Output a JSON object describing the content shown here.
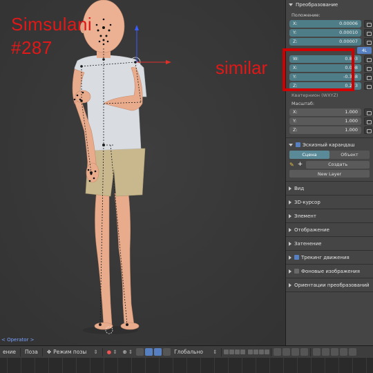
{
  "overlay": {
    "watermark_line1": "Simsulani",
    "watermark_line2": "#287",
    "annotation": "similar"
  },
  "viewport": {
    "operator_name": "< Operator >"
  },
  "properties": {
    "transform": {
      "title": "Преобразование",
      "location_label": "Положение:",
      "location": [
        {
          "axis": "X:",
          "value": "0.00006"
        },
        {
          "axis": "Y:",
          "value": "0.00010"
        },
        {
          "axis": "Z:",
          "value": "0.00007"
        }
      ],
      "rotation_mode": "4L",
      "rotation": [
        {
          "axis": "W:",
          "value": "0.893"
        },
        {
          "axis": "X:",
          "value": "0.008"
        },
        {
          "axis": "Y:",
          "value": "-0.358"
        },
        {
          "axis": "Z:",
          "value": "0.273"
        }
      ],
      "rotation_mode_label": "Кватернион (WXYZ)",
      "scale_label": "Масштаб:",
      "scale": [
        {
          "axis": "X:",
          "value": "1.000"
        },
        {
          "axis": "Y:",
          "value": "1.000"
        },
        {
          "axis": "Z:",
          "value": "1.000"
        }
      ]
    },
    "grease_pencil": {
      "title": "Эскизный карандаш",
      "tab_scene": "Сцена",
      "tab_object": "Объект",
      "create_label": "Создать",
      "new_layer_label": "New Layer"
    },
    "collapsed": [
      {
        "label": "Вид"
      },
      {
        "label": "3D-курсор"
      },
      {
        "label": "Элемент"
      },
      {
        "label": "Отображение"
      },
      {
        "label": "Затенение"
      }
    ],
    "motion_tracking": "Трекинг движения",
    "background_images": "Фоновые изображения",
    "transform_orientations": "Ориентации преобразований"
  },
  "header": {
    "view_menu": "ение",
    "pose_menu": "Поза",
    "mode_label": "Режим позы",
    "orientation_label": "Глобально"
  },
  "colors": {
    "accent_blue": "#5680c2",
    "field_teal": "#4f7d87",
    "annotation_red": "#e01818"
  }
}
